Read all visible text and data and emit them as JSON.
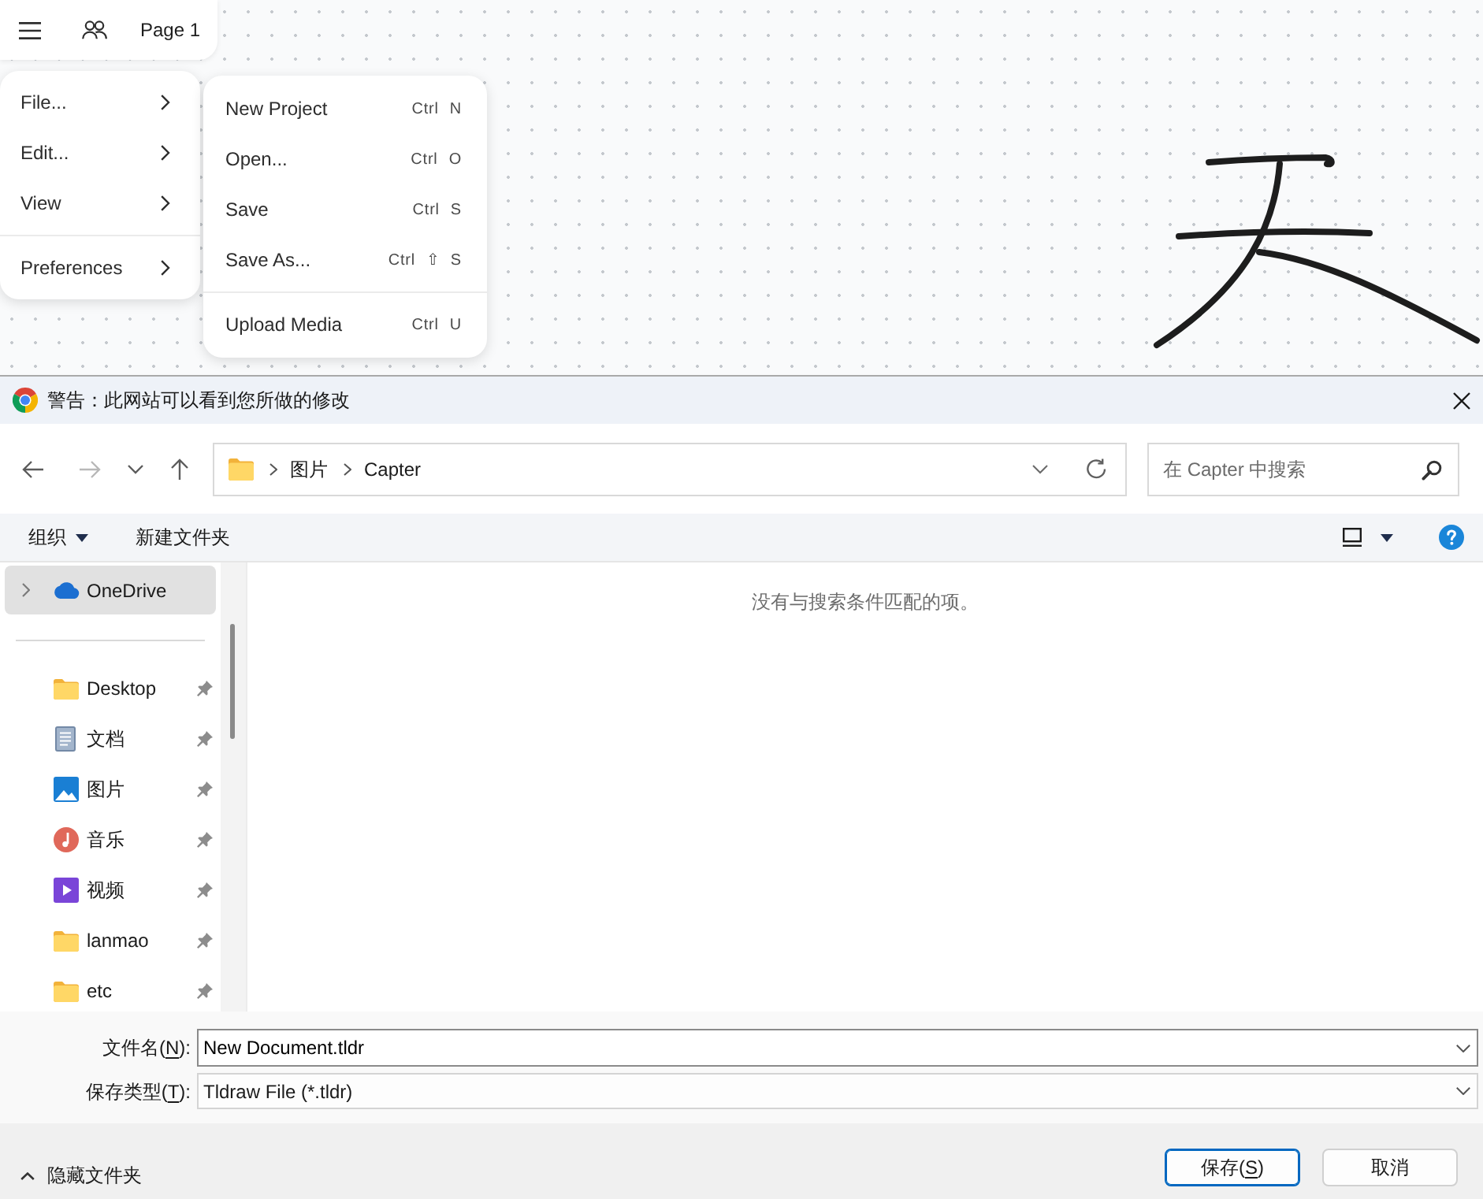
{
  "canvas": {
    "top_bar": {
      "page_name": "Page 1"
    },
    "main_menu": {
      "groups": [
        [
          {
            "label": "File...",
            "has_submenu": true
          },
          {
            "label": "Edit...",
            "has_submenu": true
          },
          {
            "label": "View",
            "has_submenu": true
          }
        ],
        [
          {
            "label": "Preferences",
            "has_submenu": true
          }
        ]
      ]
    },
    "submenu": {
      "groups": [
        [
          {
            "label": "New Project",
            "shortcut": [
              "Ctrl",
              "N"
            ]
          },
          {
            "label": "Open...",
            "shortcut": [
              "Ctrl",
              "O"
            ]
          },
          {
            "label": "Save",
            "shortcut": [
              "Ctrl",
              "S"
            ]
          },
          {
            "label": "Save As...",
            "shortcut": [
              "Ctrl",
              "⇧",
              "S"
            ]
          }
        ],
        [
          {
            "label": "Upload Media",
            "shortcut": [
              "Ctrl",
              "U"
            ]
          }
        ]
      ]
    }
  },
  "save_dialog": {
    "title": "警告：此网站可以看到您所做的修改",
    "navigation": [
      {
        "kind": "back",
        "disabled": false
      },
      {
        "kind": "forward",
        "disabled": true
      },
      {
        "kind": "recent",
        "disabled": false
      },
      {
        "kind": "up",
        "disabled": false
      }
    ],
    "address_bar": {
      "path": [
        "图片",
        "Capter"
      ]
    },
    "search": {
      "placeholder": "在 Capter 中搜索"
    },
    "toolbar": {
      "organize": "组织",
      "new_folder": "新建文件夹"
    },
    "nav_pane": {
      "root": {
        "label": "OneDrive",
        "selected": true,
        "expanded": false
      },
      "quick_access": [
        {
          "label": "Desktop",
          "kind": "folder",
          "pinned": true,
          "selected": false
        },
        {
          "label": "文档",
          "kind": "documents",
          "pinned": true,
          "selected": false
        },
        {
          "label": "图片",
          "kind": "pictures",
          "pinned": true,
          "selected": false
        },
        {
          "label": "音乐",
          "kind": "music",
          "pinned": true,
          "selected": false
        },
        {
          "label": "视频",
          "kind": "videos",
          "pinned": true,
          "selected": false
        },
        {
          "label": "lanmao",
          "kind": "folder",
          "pinned": true,
          "selected": false
        },
        {
          "label": "etc",
          "kind": "folder",
          "pinned": true,
          "selected": false
        }
      ]
    },
    "empty_message": "没有与搜索条件匹配的项。",
    "file_name": {
      "label": {
        "text": "文件名(",
        "access_key": "N",
        "suffix": "):"
      },
      "value": "New Document.tldr"
    },
    "save_type": {
      "label": {
        "text": "保存类型(",
        "access_key": "T",
        "suffix": "):"
      },
      "value": "Tldraw File (*.tldr)"
    },
    "hide_folders": {
      "label": "隐藏文件夹"
    },
    "buttons": [
      {
        "label": {
          "text": "保存(",
          "access_key": "S",
          "suffix": ")"
        },
        "default": true
      },
      {
        "label": {
          "text": "取消"
        },
        "default": false
      }
    ]
  }
}
